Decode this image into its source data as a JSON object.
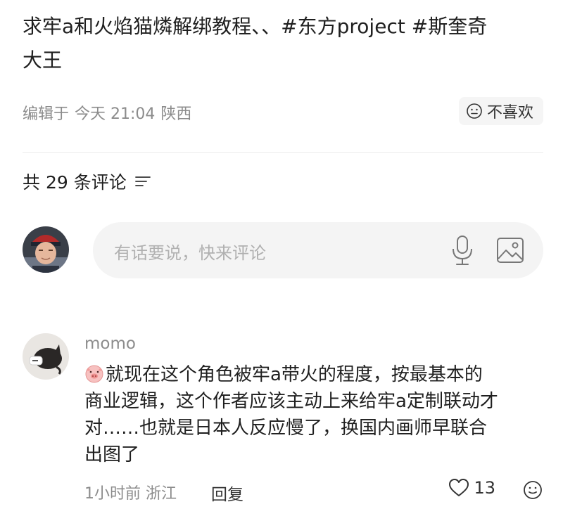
{
  "post": {
    "title_line1": "求牢a和火焰猫燐解绑教程、、",
    "tag1": "#东方project",
    "tag2": "#斯奎奇",
    "title_line2": "大王",
    "edited_label": "编辑于",
    "edited_time": "今天 21:04",
    "location": "陕西",
    "dislike_label": "不喜欢",
    "dislike_icon": "neutral-face-icon"
  },
  "comments_section": {
    "header": "共 29 条评论",
    "sort_icon": "sort-lines-icon",
    "input_placeholder": "有话要说，快来评论",
    "mic_icon": "microphone-icon",
    "image_icon": "image-icon"
  },
  "comments": [
    {
      "username": "momo",
      "emoji": "pig-face-emoji",
      "lines": [
        "就现在这个角色被牢a带火的程度，按最基本的",
        "商业逻辑，这个作者应该主动上来给牢a定制联动才",
        "对……也就是日本人反应慢了，换国内画师早联合",
        "出图了"
      ],
      "time": "1小时前",
      "location": "浙江",
      "reply_label": "回复",
      "likes": "13"
    }
  ],
  "colors": {
    "text_primary": "#1f1f1f",
    "text_secondary": "#8c8c8c",
    "input_bg": "#f4f4f4",
    "placeholder": "#b0b0b0"
  }
}
